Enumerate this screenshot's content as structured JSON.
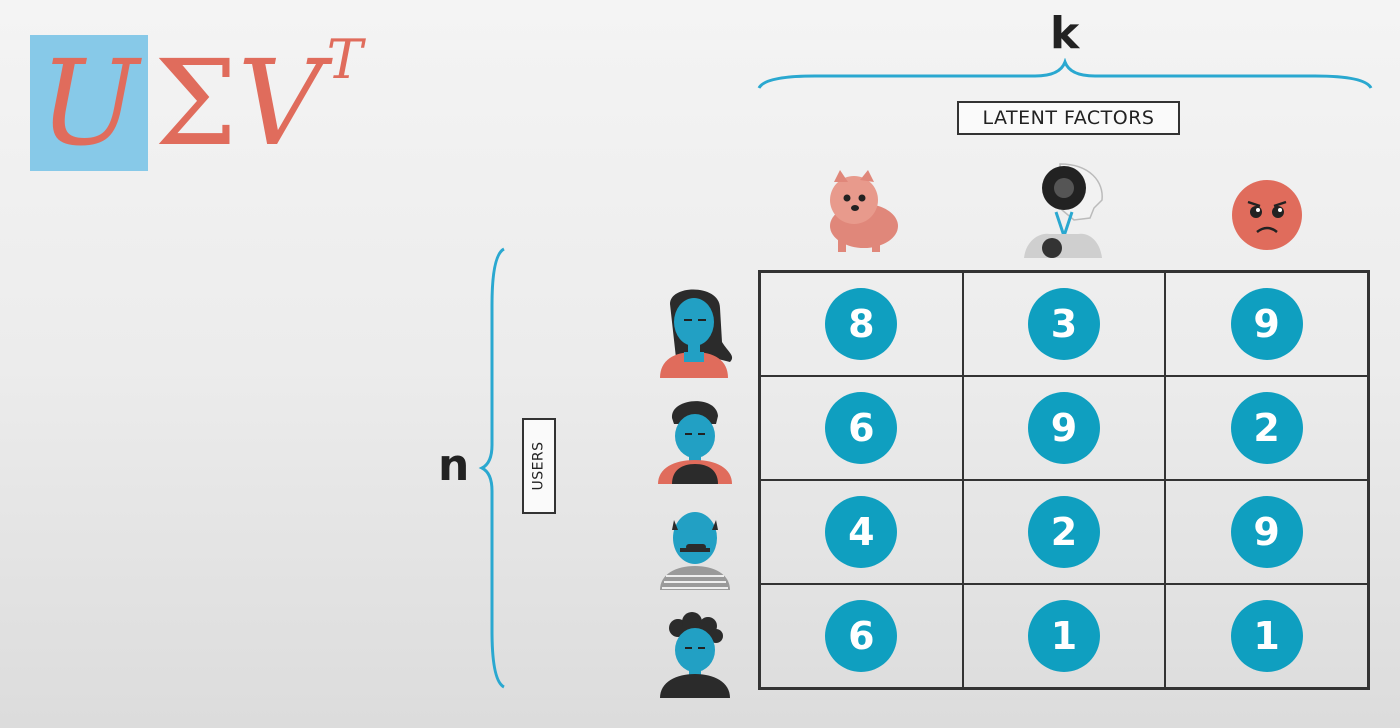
{
  "formula": {
    "u": "U",
    "sigma": "Σ",
    "v": "V",
    "sup": "T"
  },
  "labels": {
    "k": "k",
    "n": "n",
    "latent": "LATENT FACTORS",
    "users": "USERS"
  },
  "factors": [
    {
      "icon": "dog-icon"
    },
    {
      "icon": "robot-icon"
    },
    {
      "icon": "sad-face-icon"
    }
  ],
  "users": [
    {
      "icon": "user-woman-icon"
    },
    {
      "icon": "user-man-icon"
    },
    {
      "icon": "user-older-man-icon"
    },
    {
      "icon": "user-curly-man-icon"
    }
  ],
  "matrix": [
    [
      "8",
      "3",
      "9"
    ],
    [
      "6",
      "9",
      "2"
    ],
    [
      "4",
      "2",
      "9"
    ],
    [
      "6",
      "1",
      "1"
    ]
  ],
  "colors": {
    "accent": "#0f9fc0",
    "coral": "#e06c5c",
    "highlight": "#87c9e8"
  }
}
